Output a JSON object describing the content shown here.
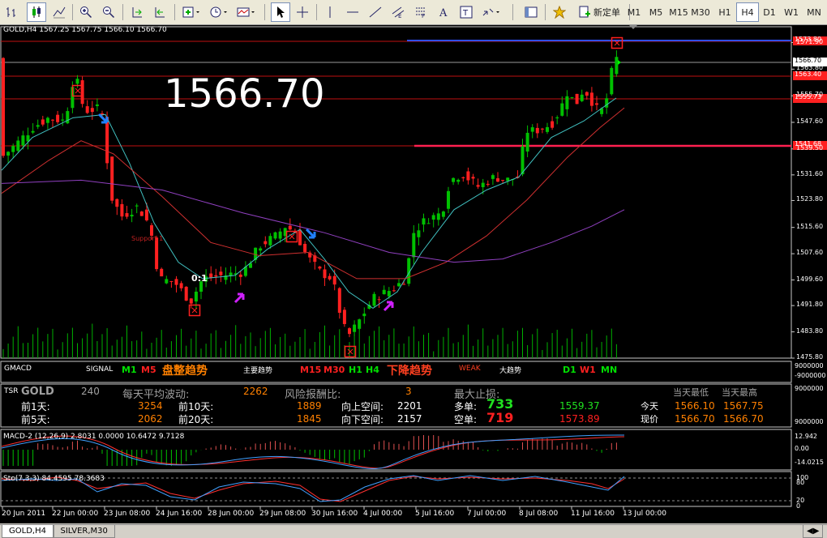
{
  "toolbar": {
    "new_order_label": "新定单",
    "timeframes": [
      "M1",
      "M5",
      "M15",
      "M30",
      "H1",
      "H4",
      "D1",
      "W1",
      "MN"
    ],
    "active_timeframe": "H4"
  },
  "chart": {
    "info_line": "GOLD,H4  1567.25 1567.75 1566.10 1566.70",
    "big_price": "1566.70",
    "support_label": "Support 1",
    "ratio_label": "0:1",
    "price_ticks": [
      "1571.90",
      "1563.80",
      "1555.70",
      "1547.60",
      "1539.50",
      "1531.60",
      "1523.80",
      "1515.60",
      "1507.60",
      "1499.60",
      "1491.80",
      "1483.80",
      "1475.80"
    ],
    "price_tags": [
      {
        "text": "1573.80",
        "color": "#ff2020"
      },
      {
        "text": "1566.70",
        "color": "#ffffff"
      },
      {
        "text": "1563.40",
        "color": "#ff2020"
      },
      {
        "text": "1555.73",
        "color": "#ff2020"
      },
      {
        "text": "1541.68",
        "color": "#ff2020"
      }
    ],
    "colors": {
      "bull": "#00c000",
      "bear": "#ff2020",
      "ma_fast": "#40c0c0",
      "ma_mid": "#d03030",
      "ma_slow": "#9040c0",
      "blue_line": "#3050ff",
      "red_line": "#ff2050"
    }
  },
  "gmacd": {
    "title": "GMACD",
    "signal_label": "SIGNAL",
    "items": [
      {
        "text": "M1",
        "color": "#00e000"
      },
      {
        "text": "M5",
        "color": "#ff2020"
      },
      {
        "text": "盘整趋势",
        "color": "#ff8000"
      },
      {
        "text": "主要趋势",
        "color": "#ffffff"
      },
      {
        "text": "M15",
        "color": "#ff2020"
      },
      {
        "text": "M30",
        "color": "#ff2020"
      },
      {
        "text": "H1",
        "color": "#00e000"
      },
      {
        "text": "H4",
        "color": "#00e000"
      },
      {
        "text": "下降趋势",
        "color": "#ff4020"
      },
      {
        "text": "WEAK",
        "color": "#ff4020"
      },
      {
        "text": "大趋势",
        "color": "#ffffff"
      },
      {
        "text": "D1",
        "color": "#00e000"
      },
      {
        "text": "W1",
        "color": "#ff2020"
      },
      {
        "text": "MN",
        "color": "#00e000"
      }
    ],
    "scale_top": "9000000",
    "scale_bottom": "-9000000"
  },
  "tsr": {
    "title": "TSR",
    "symbol": "GOLD",
    "period_value": "240",
    "avg_label": "每天平均波动:",
    "avg_value": "2262",
    "risk_label": "风险报酬比:",
    "risk_value": "3",
    "stop_label": "最大止损:",
    "day1_label": "前1天:",
    "day1_value": "3254",
    "day5_label": "前5天:",
    "day5_value": "2062",
    "day10_label": "前10天:",
    "day10_value": "1889",
    "day20_label": "前20天:",
    "day20_value": "1845",
    "up_label": "向上空间:",
    "up_value": "2201",
    "down_label": "向下空间:",
    "down_value": "2157",
    "long_label": "多单:",
    "long_value": "733",
    "long_price": "1559.37",
    "short_label": "空单:",
    "short_value": "719",
    "short_price": "1573.89",
    "low_header": "当天最低",
    "high_header": "当天最高",
    "today_label": "今天",
    "today_low": "1566.10",
    "today_high": "1567.75",
    "now_label": "现价",
    "now_low": "1566.70",
    "now_high": "1566.70",
    "scale_top": "9000000",
    "scale_bottom": "9000000"
  },
  "macd": {
    "info": "MACD-2 (12,26,9) 2.8031 0.0000 10.6472 9.7128",
    "scale": [
      "12.942",
      "0.00",
      "-14.0215"
    ]
  },
  "stoch": {
    "info": "Sto(7,3,3) 84.4595 78.3683",
    "scale": [
      "100",
      "80",
      "20",
      "0"
    ]
  },
  "time_axis": [
    "20 Jun 2011",
    "22 Jun 00:00",
    "23 Jun 08:00",
    "24 Jun 16:00",
    "28 Jun 00:00",
    "29 Jun 08:00",
    "30 Jun 16:00",
    "4 Jul 00:00",
    "5 Jul 16:00",
    "7 Jul 00:00",
    "8 Jul 08:00",
    "11 Jul 16:00",
    "13 Jul 00:00"
  ],
  "tabs": [
    "GOLD,H4",
    "SILVER,M30"
  ],
  "active_tab": "GOLD,H4"
}
